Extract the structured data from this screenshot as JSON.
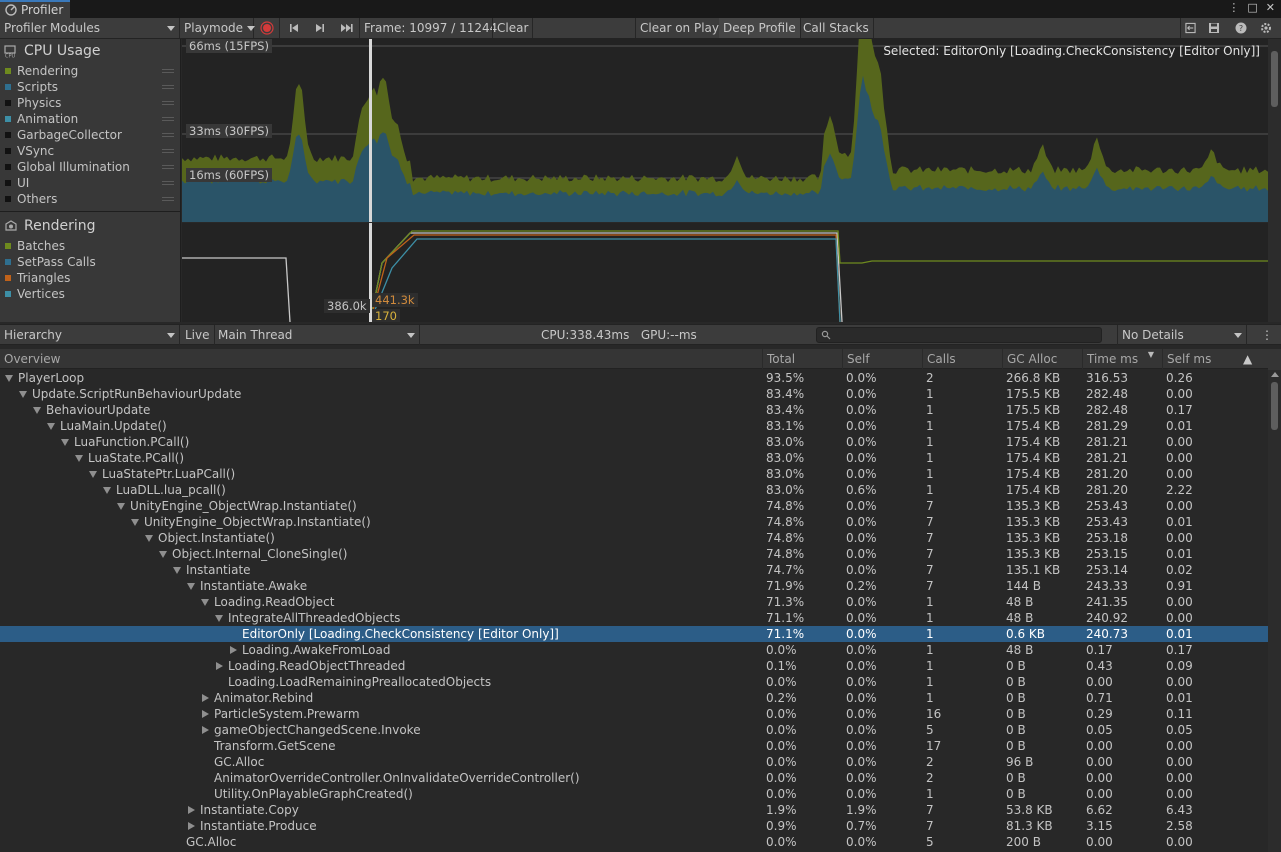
{
  "window": {
    "tab_title": "Profiler"
  },
  "toolbar": {
    "modules_dropdown": "Profiler Modules",
    "mode_dropdown": "Playmode",
    "frame_label": "Frame: 10997 / 11244",
    "clear": "Clear",
    "clear_on_play": "Clear on Play",
    "deep_profile": "Deep Profile",
    "call_stacks": "Call Stacks"
  },
  "cpu_module": {
    "title": "CPU Usage",
    "icon": "cpu-icon",
    "legend": [
      {
        "label": "Rendering",
        "color": "#6e8a1e"
      },
      {
        "label": "Scripts",
        "color": "#2f6f8f"
      },
      {
        "label": "Physics",
        "color": "#111111"
      },
      {
        "label": "Animation",
        "color": "#3d8fa6"
      },
      {
        "label": "GarbageCollector",
        "color": "#111111"
      },
      {
        "label": "VSync",
        "color": "#111111"
      },
      {
        "label": "Global Illumination",
        "color": "#111111"
      },
      {
        "label": "UI",
        "color": "#111111"
      },
      {
        "label": "Others",
        "color": "#111111"
      }
    ],
    "fps_lines": [
      "66ms (15FPS)",
      "33ms (30FPS)",
      "16ms (60FPS)"
    ],
    "selected_label": "Selected: EditorOnly [Loading.CheckConsistency [Editor Only]]"
  },
  "rendering_module": {
    "title": "Rendering",
    "icon": "rendering-icon",
    "legend": [
      {
        "label": "Batches",
        "color": "#6e8a1e"
      },
      {
        "label": "SetPass Calls",
        "color": "#2f6f8f"
      },
      {
        "label": "Triangles",
        "color": "#c0621a"
      },
      {
        "label": "Vertices",
        "color": "#3d8fa6"
      }
    ],
    "values": [
      "386.0k",
      "441.3k",
      "170"
    ]
  },
  "hierarchy_toolbar": {
    "view_dropdown": "Hierarchy",
    "live": "Live",
    "thread_dropdown": "Main Thread",
    "timing": "CPU:338.43ms   GPU:--ms",
    "details_dropdown": "No Details"
  },
  "table": {
    "headers": [
      "Overview",
      "Total",
      "Self",
      "Calls",
      "GC Alloc",
      "Time ms",
      "Self ms"
    ],
    "rows": [
      {
        "depth": 0,
        "exp": "down",
        "name": "PlayerLoop",
        "total": "93.5%",
        "self": "0.0%",
        "calls": "2",
        "gc": "266.8 KB",
        "time": "316.53",
        "selfms": "0.26"
      },
      {
        "depth": 1,
        "exp": "down",
        "name": "Update.ScriptRunBehaviourUpdate",
        "total": "83.4%",
        "self": "0.0%",
        "calls": "1",
        "gc": "175.5 KB",
        "time": "282.48",
        "selfms": "0.00"
      },
      {
        "depth": 2,
        "exp": "down",
        "name": "BehaviourUpdate",
        "total": "83.4%",
        "self": "0.0%",
        "calls": "1",
        "gc": "175.5 KB",
        "time": "282.48",
        "selfms": "0.17"
      },
      {
        "depth": 3,
        "exp": "down",
        "name": "LuaMain.Update()",
        "total": "83.1%",
        "self": "0.0%",
        "calls": "1",
        "gc": "175.4 KB",
        "time": "281.29",
        "selfms": "0.01"
      },
      {
        "depth": 4,
        "exp": "down",
        "name": "LuaFunction.PCall()",
        "total": "83.0%",
        "self": "0.0%",
        "calls": "1",
        "gc": "175.4 KB",
        "time": "281.21",
        "selfms": "0.00"
      },
      {
        "depth": 5,
        "exp": "down",
        "name": "LuaState.PCall()",
        "total": "83.0%",
        "self": "0.0%",
        "calls": "1",
        "gc": "175.4 KB",
        "time": "281.21",
        "selfms": "0.00"
      },
      {
        "depth": 6,
        "exp": "down",
        "name": "LuaStatePtr.LuaPCall()",
        "total": "83.0%",
        "self": "0.0%",
        "calls": "1",
        "gc": "175.4 KB",
        "time": "281.20",
        "selfms": "0.00"
      },
      {
        "depth": 7,
        "exp": "down",
        "name": "LuaDLL.lua_pcall()",
        "total": "83.0%",
        "self": "0.6%",
        "calls": "1",
        "gc": "175.4 KB",
        "time": "281.20",
        "selfms": "2.22"
      },
      {
        "depth": 8,
        "exp": "down",
        "name": "UnityEngine_ObjectWrap.Instantiate()",
        "total": "74.8%",
        "self": "0.0%",
        "calls": "7",
        "gc": "135.3 KB",
        "time": "253.43",
        "selfms": "0.00"
      },
      {
        "depth": 9,
        "exp": "down",
        "name": "UnityEngine_ObjectWrap.Instantiate()",
        "total": "74.8%",
        "self": "0.0%",
        "calls": "7",
        "gc": "135.3 KB",
        "time": "253.43",
        "selfms": "0.01"
      },
      {
        "depth": 10,
        "exp": "down",
        "name": "Object.Instantiate()",
        "total": "74.8%",
        "self": "0.0%",
        "calls": "7",
        "gc": "135.3 KB",
        "time": "253.18",
        "selfms": "0.00"
      },
      {
        "depth": 11,
        "exp": "down",
        "name": "Object.Internal_CloneSingle()",
        "total": "74.8%",
        "self": "0.0%",
        "calls": "7",
        "gc": "135.3 KB",
        "time": "253.15",
        "selfms": "0.01"
      },
      {
        "depth": 12,
        "exp": "down",
        "name": "Instantiate",
        "total": "74.7%",
        "self": "0.0%",
        "calls": "7",
        "gc": "135.1 KB",
        "time": "253.14",
        "selfms": "0.02"
      },
      {
        "depth": 13,
        "exp": "down",
        "name": "Instantiate.Awake",
        "total": "71.9%",
        "self": "0.2%",
        "calls": "7",
        "gc": "144 B",
        "time": "243.33",
        "selfms": "0.91"
      },
      {
        "depth": 14,
        "exp": "down",
        "name": "Loading.ReadObject",
        "total": "71.3%",
        "self": "0.0%",
        "calls": "1",
        "gc": "48 B",
        "time": "241.35",
        "selfms": "0.00"
      },
      {
        "depth": 15,
        "exp": "down",
        "name": "IntegrateAllThreadedObjects",
        "total": "71.1%",
        "self": "0.0%",
        "calls": "1",
        "gc": "48 B",
        "time": "240.92",
        "selfms": "0.00"
      },
      {
        "depth": 16,
        "exp": "none",
        "name": "EditorOnly [Loading.CheckConsistency [Editor Only]]",
        "total": "71.1%",
        "self": "0.0%",
        "calls": "1",
        "gc": "0.6 KB",
        "time": "240.73",
        "selfms": "0.01",
        "selected": true
      },
      {
        "depth": 16,
        "exp": "right",
        "name": "Loading.AwakeFromLoad",
        "total": "0.0%",
        "self": "0.0%",
        "calls": "1",
        "gc": "48 B",
        "time": "0.17",
        "selfms": "0.17"
      },
      {
        "depth": 15,
        "exp": "right",
        "name": "Loading.ReadObjectThreaded",
        "total": "0.1%",
        "self": "0.0%",
        "calls": "1",
        "gc": "0 B",
        "time": "0.43",
        "selfms": "0.09"
      },
      {
        "depth": 15,
        "exp": "none",
        "name": "Loading.LoadRemainingPreallocatedObjects",
        "total": "0.0%",
        "self": "0.0%",
        "calls": "1",
        "gc": "0 B",
        "time": "0.00",
        "selfms": "0.00"
      },
      {
        "depth": 14,
        "exp": "right",
        "name": "Animator.Rebind",
        "total": "0.2%",
        "self": "0.0%",
        "calls": "1",
        "gc": "0 B",
        "time": "0.71",
        "selfms": "0.01"
      },
      {
        "depth": 14,
        "exp": "right",
        "name": "ParticleSystem.Prewarm",
        "total": "0.0%",
        "self": "0.0%",
        "calls": "16",
        "gc": "0 B",
        "time": "0.29",
        "selfms": "0.11"
      },
      {
        "depth": 14,
        "exp": "right",
        "name": "gameObjectChangedScene.Invoke",
        "total": "0.0%",
        "self": "0.0%",
        "calls": "5",
        "gc": "0 B",
        "time": "0.05",
        "selfms": "0.05"
      },
      {
        "depth": 14,
        "exp": "none",
        "name": "Transform.GetScene",
        "total": "0.0%",
        "self": "0.0%",
        "calls": "17",
        "gc": "0 B",
        "time": "0.00",
        "selfms": "0.00"
      },
      {
        "depth": 14,
        "exp": "none",
        "name": "GC.Alloc",
        "total": "0.0%",
        "self": "0.0%",
        "calls": "2",
        "gc": "96 B",
        "time": "0.00",
        "selfms": "0.00"
      },
      {
        "depth": 14,
        "exp": "none",
        "name": "AnimatorOverrideController.OnInvalidateOverrideController()",
        "total": "0.0%",
        "self": "0.0%",
        "calls": "2",
        "gc": "0 B",
        "time": "0.00",
        "selfms": "0.00"
      },
      {
        "depth": 14,
        "exp": "none",
        "name": "Utility.OnPlayableGraphCreated()",
        "total": "0.0%",
        "self": "0.0%",
        "calls": "1",
        "gc": "0 B",
        "time": "0.00",
        "selfms": "0.00"
      },
      {
        "depth": 13,
        "exp": "right",
        "name": "Instantiate.Copy",
        "total": "1.9%",
        "self": "1.9%",
        "calls": "7",
        "gc": "53.8 KB",
        "time": "6.62",
        "selfms": "6.43"
      },
      {
        "depth": 13,
        "exp": "right",
        "name": "Instantiate.Produce",
        "total": "0.9%",
        "self": "0.7%",
        "calls": "7",
        "gc": "81.3 KB",
        "time": "3.15",
        "selfms": "2.58"
      },
      {
        "depth": 12,
        "exp": "none",
        "name": "GC.Alloc",
        "total": "0.0%",
        "self": "0.0%",
        "calls": "5",
        "gc": "200 B",
        "time": "0.00",
        "selfms": "0.00"
      }
    ]
  }
}
